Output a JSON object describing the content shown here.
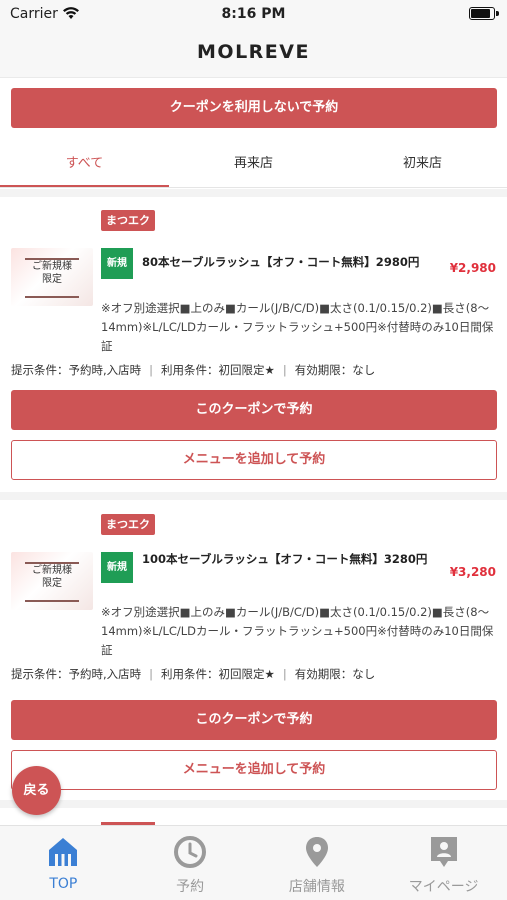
{
  "status": {
    "carrier": "Carrier",
    "time": "8:16 PM"
  },
  "nav": {
    "title": "MOLREVE"
  },
  "no_coupon_button": "クーポンを利用しないで予約",
  "tabs": [
    {
      "label": "すべて",
      "active": true
    },
    {
      "label": "再来店",
      "active": false
    },
    {
      "label": "初来店",
      "active": false
    }
  ],
  "coupons": [
    {
      "tag": "まつエク",
      "thumb_text": "ご新規様\n限定",
      "new_badge": "新規",
      "title": "80本セーブルラッシュ【オフ・コート無料】2980円",
      "price": "¥2,980",
      "description": "※オフ別途選択■上のみ■カール(J/B/C/D)■太さ(0.1/0.15/0.2)■長さ(8〜14mm)※L/LC/LDカール・フラットラッシュ+500円※付替時のみ10日間保証",
      "conditions": {
        "present": "提示条件：予約時,入店時",
        "use": "利用条件：初回限定★",
        "validity": "有効期限：なし"
      },
      "use_button": "このクーポンで予約",
      "add_menu_button": "メニューを追加して予約"
    },
    {
      "tag": "まつエク",
      "thumb_text": "ご新規様\n限定",
      "new_badge": "新規",
      "title": "100本セーブルラッシュ【オフ・コート無料】3280円",
      "price": "¥3,280",
      "description": "※オフ別途選択■上のみ■カール(J/B/C/D)■太さ(0.1/0.15/0.2)■長さ(8〜14mm)※L/LC/LDカール・フラットラッシュ+500円※付替時のみ10日間保証",
      "conditions": {
        "present": "提示条件：予約時,入店時",
        "use": "利用条件：初回限定★",
        "validity": "有効期限：なし"
      },
      "use_button": "このクーポンで予約",
      "add_menu_button": "メニューを追加して予約"
    }
  ],
  "back_button": "戻る",
  "tab_bar": [
    {
      "label": "TOP",
      "icon": "home-icon",
      "active": true
    },
    {
      "label": "予約",
      "icon": "clock-icon",
      "active": false
    },
    {
      "label": "店舗情報",
      "icon": "location-pin-icon",
      "active": false
    },
    {
      "label": "マイページ",
      "icon": "profile-icon",
      "active": false
    }
  ],
  "colors": {
    "accent": "#cd5455",
    "price": "#e0303c",
    "new_badge": "#1f9d55",
    "tab_active": "#3b7fd4"
  }
}
